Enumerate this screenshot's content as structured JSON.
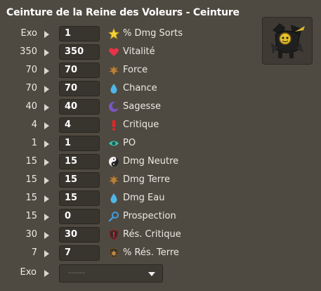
{
  "item": {
    "title": "Ceinture de la Reine des Voleurs - Ceinture",
    "icon": "thief-queen-belt-icon"
  },
  "rows": [
    {
      "base": "Exo",
      "value": "1",
      "label": "% Dmg Sorts",
      "icon": "star-icon"
    },
    {
      "base": "350",
      "value": "350",
      "label": "Vitalité",
      "icon": "heart-icon"
    },
    {
      "base": "70",
      "value": "70",
      "label": "Force",
      "icon": "earth-element-icon"
    },
    {
      "base": "70",
      "value": "70",
      "label": "Chance",
      "icon": "water-drop-icon"
    },
    {
      "base": "40",
      "value": "40",
      "label": "Sagesse",
      "icon": "wisdom-moon-icon"
    },
    {
      "base": "4",
      "value": "4",
      "label": "Critique",
      "icon": "critical-exclamation-icon"
    },
    {
      "base": "1",
      "value": "1",
      "label": "PO",
      "icon": "range-eye-icon"
    },
    {
      "base": "15",
      "value": "15",
      "label": "Dmg Neutre",
      "icon": "neutral-yin-yang-icon"
    },
    {
      "base": "15",
      "value": "15",
      "label": "Dmg Terre",
      "icon": "earth-element-icon"
    },
    {
      "base": "15",
      "value": "15",
      "label": "Dmg Eau",
      "icon": "water-drop-icon"
    },
    {
      "base": "15",
      "value": "0",
      "label": "Prospection",
      "icon": "prospecting-key-icon"
    },
    {
      "base": "30",
      "value": "30",
      "label": "Rés. Critique",
      "icon": "critical-resistance-shield-icon"
    },
    {
      "base": "7",
      "value": "7",
      "label": "% Rés. Terre",
      "icon": "earth-resistance-icon"
    }
  ],
  "exo_row": {
    "base": "Exo",
    "select_placeholder": "------"
  }
}
